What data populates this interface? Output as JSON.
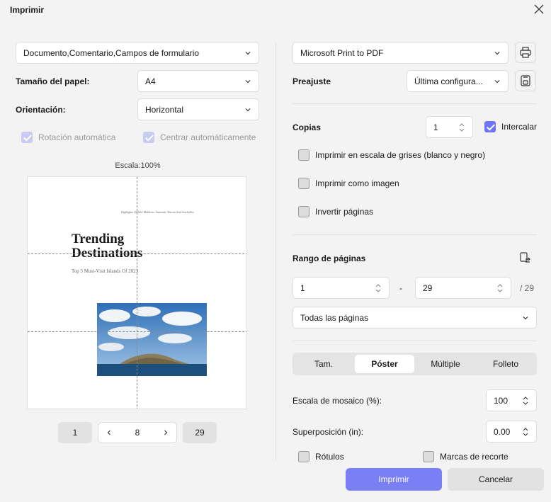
{
  "window": {
    "title": "Imprimir"
  },
  "left": {
    "content_select": "Documento,Comentario,Campos de formulario",
    "paper_size_label": "Tamaño del papel:",
    "paper_size_value": "A4",
    "orientation_label": "Orientación:",
    "orientation_value": "Horizontal",
    "auto_rotate_label": "Rotación automática",
    "auto_center_label": "Centrar automáticamente",
    "scale_label": "Escala:100%",
    "preview": {
      "small_header": "Highlights Of Bali, Maldives, Santorini, Hawaii And Seychelles",
      "heading_line1": "Trending",
      "heading_line2": "Destinations",
      "subheading": "Top 5 Must-Visit Islands Of 2023"
    },
    "pager": {
      "first": "1",
      "current": "8",
      "last": "29"
    }
  },
  "right": {
    "printer_value": "Microsoft Print to PDF",
    "preset_label": "Preajuste",
    "preset_value": "Última configura...",
    "copies_label": "Copias",
    "copies_value": "1",
    "collate_label": "Intercalar",
    "grayscale_label": "Imprimir en escala de grises (blanco y negro)",
    "as_image_label": "Imprimir como imagen",
    "reverse_label": "Invertir páginas",
    "page_range_label": "Rango de páginas",
    "range_from": "1",
    "range_dash": "-",
    "range_to": "29",
    "range_total": "/ 29",
    "range_mode": "Todas las páginas",
    "tabs": [
      "Tam.",
      "Póster",
      "Múltiple",
      "Folleto"
    ],
    "tile_scale_label": "Escala de mosaico (%):",
    "tile_scale_value": "100",
    "overlap_label": "Superposición (in):",
    "overlap_value": "0.00",
    "labels_label": "Rótulos",
    "crop_marks_label": "Marcas de recorte"
  },
  "footer": {
    "print": "Imprimir",
    "cancel": "Cancelar"
  },
  "colors": {
    "accent": "#7b7ff6",
    "background": "#f3f3f3"
  }
}
